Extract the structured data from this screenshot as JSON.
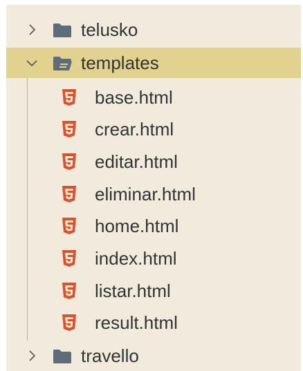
{
  "explorer": {
    "folders": [
      {
        "name": "telusko",
        "expanded": false,
        "icon": "folder-icon"
      },
      {
        "name": "templates",
        "expanded": true,
        "selected": true,
        "icon": "folder-open-icon"
      },
      {
        "name": "travello",
        "expanded": false,
        "icon": "folder-icon"
      }
    ],
    "files": [
      {
        "name": "base.html",
        "icon": "html5-icon"
      },
      {
        "name": "crear.html",
        "icon": "html5-icon"
      },
      {
        "name": "editar.html",
        "icon": "html5-icon"
      },
      {
        "name": "eliminar.html",
        "icon": "html5-icon"
      },
      {
        "name": "home.html",
        "icon": "html5-icon"
      },
      {
        "name": "index.html",
        "icon": "html5-icon"
      },
      {
        "name": "listar.html",
        "icon": "html5-icon"
      },
      {
        "name": "result.html",
        "icon": "html5-icon"
      }
    ]
  },
  "colors": {
    "background": "#f0ebdd",
    "selected_row": "#e1d28f",
    "folder": "#5f6c7b",
    "html5": "#e44d26",
    "text": "#333333"
  }
}
